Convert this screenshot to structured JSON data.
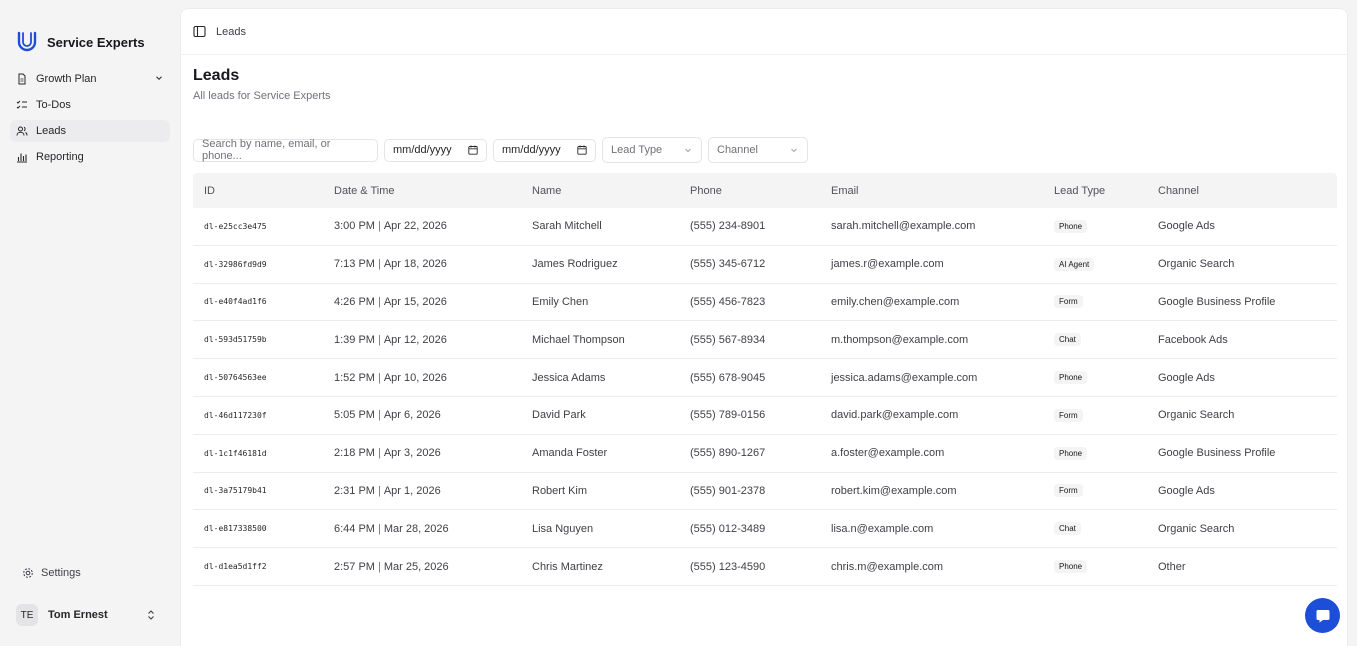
{
  "brand": {
    "name": "Service Experts"
  },
  "sidebar": {
    "items": [
      {
        "label": "Growth Plan"
      },
      {
        "label": "To-Dos"
      },
      {
        "label": "Leads"
      },
      {
        "label": "Reporting"
      }
    ],
    "settings_label": "Settings",
    "user": {
      "initials": "TE",
      "name": "Tom Ernest"
    }
  },
  "topbar": {
    "breadcrumb": "Leads"
  },
  "page": {
    "title": "Leads",
    "subtitle": "All leads for Service Experts"
  },
  "filters": {
    "search_placeholder": "Search by name, email, or phone...",
    "date_from": "mm/dd/yyyy",
    "date_to": "mm/dd/yyyy",
    "lead_type": "Lead Type",
    "channel": "Channel"
  },
  "table": {
    "headers": {
      "id": "ID",
      "datetime": "Date & Time",
      "name": "Name",
      "phone": "Phone",
      "email": "Email",
      "lead_type": "Lead Type",
      "channel": "Channel"
    },
    "rows": [
      {
        "id": "dl-e25cc3e475",
        "time": "3:00 PM",
        "date": "Apr 22, 2026",
        "name": "Sarah Mitchell",
        "phone": "(555) 234-8901",
        "email": "sarah.mitchell@example.com",
        "lead_type": "Phone",
        "channel": "Google Ads"
      },
      {
        "id": "dl-32986fd9d9",
        "time": "7:13 PM",
        "date": "Apr 18, 2026",
        "name": "James Rodriguez",
        "phone": "(555) 345-6712",
        "email": "james.r@example.com",
        "lead_type": "AI Agent",
        "channel": "Organic Search"
      },
      {
        "id": "dl-e40f4ad1f6",
        "time": "4:26 PM",
        "date": "Apr 15, 2026",
        "name": "Emily Chen",
        "phone": "(555) 456-7823",
        "email": "emily.chen@example.com",
        "lead_type": "Form",
        "channel": "Google Business Profile"
      },
      {
        "id": "dl-593d51759b",
        "time": "1:39 PM",
        "date": "Apr 12, 2026",
        "name": "Michael Thompson",
        "phone": "(555) 567-8934",
        "email": "m.thompson@example.com",
        "lead_type": "Chat",
        "channel": "Facebook Ads"
      },
      {
        "id": "dl-50764563ee",
        "time": "1:52 PM",
        "date": "Apr 10, 2026",
        "name": "Jessica Adams",
        "phone": "(555) 678-9045",
        "email": "jessica.adams@example.com",
        "lead_type": "Phone",
        "channel": "Google Ads"
      },
      {
        "id": "dl-46d117230f",
        "time": "5:05 PM",
        "date": "Apr 6, 2026",
        "name": "David Park",
        "phone": "(555) 789-0156",
        "email": "david.park@example.com",
        "lead_type": "Form",
        "channel": "Organic Search"
      },
      {
        "id": "dl-1c1f46181d",
        "time": "2:18 PM",
        "date": "Apr 3, 2026",
        "name": "Amanda Foster",
        "phone": "(555) 890-1267",
        "email": "a.foster@example.com",
        "lead_type": "Phone",
        "channel": "Google Business Profile"
      },
      {
        "id": "dl-3a75179b41",
        "time": "2:31 PM",
        "date": "Apr 1, 2026",
        "name": "Robert Kim",
        "phone": "(555) 901-2378",
        "email": "robert.kim@example.com",
        "lead_type": "Form",
        "channel": "Google Ads"
      },
      {
        "id": "dl-e817338500",
        "time": "6:44 PM",
        "date": "Mar 28, 2026",
        "name": "Lisa Nguyen",
        "phone": "(555) 012-3489",
        "email": "lisa.n@example.com",
        "lead_type": "Chat",
        "channel": "Organic Search"
      },
      {
        "id": "dl-d1ea5d1ff2",
        "time": "2:57 PM",
        "date": "Mar 25, 2026",
        "name": "Chris Martinez",
        "phone": "(555) 123-4590",
        "email": "chris.m@example.com",
        "lead_type": "Phone",
        "channel": "Other"
      }
    ]
  },
  "colors": {
    "accent": "#1d4ed8",
    "sidebar_bg": "#f4f4f5",
    "header_bg": "#f4f4f5"
  }
}
